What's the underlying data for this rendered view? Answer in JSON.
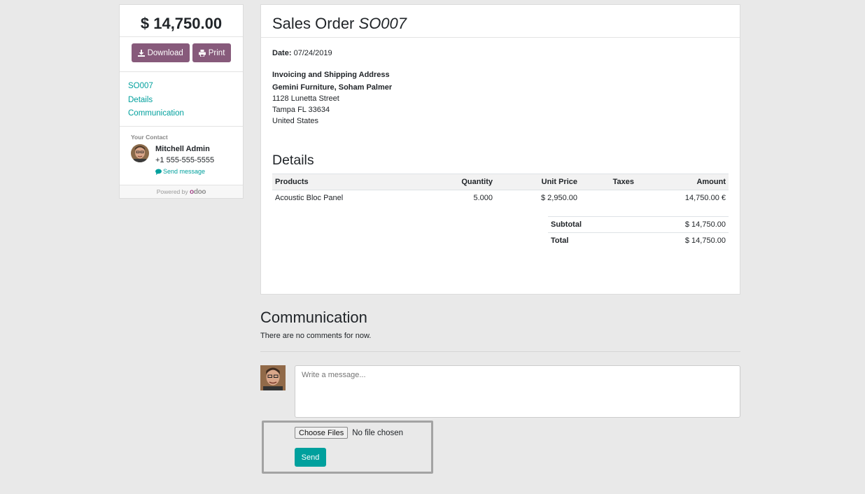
{
  "sidebar": {
    "amount": "$ 14,750.00",
    "download_label": "Download",
    "print_label": "Print",
    "nav": [
      {
        "label": "SO007"
      },
      {
        "label": "Details"
      },
      {
        "label": "Communication"
      }
    ],
    "contact": {
      "title": "Your Contact",
      "name": "Mitchell Admin",
      "phone": "+1 555-555-5555",
      "send_message": "Send message"
    },
    "powered_by": "Powered by",
    "brand": "odoo"
  },
  "order": {
    "title_prefix": "Sales Order",
    "number": "SO007",
    "date_label": "Date:",
    "date_value": "07/24/2019",
    "address_title": "Invoicing and Shipping Address",
    "customer_name": "Gemini Furniture, Soham Palmer",
    "address_lines": [
      "1128 Lunetta Street",
      "Tampa FL 33634",
      "United States"
    ],
    "details_title": "Details",
    "columns": {
      "products": "Products",
      "quantity": "Quantity",
      "unit_price": "Unit Price",
      "taxes": "Taxes",
      "amount": "Amount"
    },
    "lines": [
      {
        "product": "Acoustic Bloc Panel",
        "quantity": "5.000",
        "unit_price": "$ 2,950.00",
        "taxes": "",
        "amount": "14,750.00 €"
      }
    ],
    "subtotal_label": "Subtotal",
    "subtotal_value": "$ 14,750.00",
    "total_label": "Total",
    "total_value": "$ 14,750.00"
  },
  "communication": {
    "title": "Communication",
    "empty_text": "There are no comments for now.",
    "message_placeholder": "Write a message...",
    "choose_files_label": "Choose Files",
    "no_file_text": "No file chosen",
    "send_label": "Send"
  },
  "colors": {
    "primary_purple": "#875a7b",
    "accent_teal": "#00a09d",
    "background": "#e9e9e9"
  }
}
